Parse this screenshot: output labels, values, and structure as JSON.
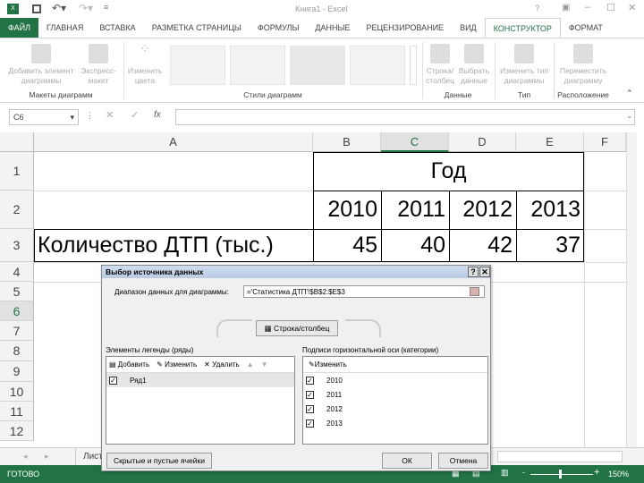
{
  "title": "Книга1 - Excel",
  "quick_access": [
    "save-icon",
    "undo-icon",
    "redo-icon",
    "customize-icon"
  ],
  "window_controls": [
    "?",
    "restore-icon",
    "minimize-icon",
    "maximize-icon",
    "close-icon"
  ],
  "tabs": [
    "ФАЙЛ",
    "ГЛАВНАЯ",
    "ВСТАВКА",
    "РАЗМЕТКА СТРАНИЦЫ",
    "ФОРМУЛЫ",
    "ДАННЫЕ",
    "РЕЦЕНЗИРОВАНИЕ",
    "ВИД",
    "КОНСТРУКТОР",
    "ФОРМАТ"
  ],
  "active_tab": "КОНСТРУКТОР",
  "ribbon": {
    "add_element": "Добавить элемент диаграммы",
    "express": "Экспресс-макет",
    "change_colors": "Изменить цвета",
    "row_col": "Строка/ столбец",
    "select_data": "Выбрать данные",
    "change_type": "Изменить тип диаграммы",
    "move_chart": "Переместить диаграмму",
    "groups": [
      "Макеты диаграмм",
      "Стили диаграмм",
      "Данные",
      "Тип",
      "Расположение"
    ]
  },
  "name_box": "C6",
  "formula": "",
  "columns": [
    "A",
    "B",
    "C",
    "D",
    "E",
    "F"
  ],
  "selected_column": "C",
  "rows": [
    "1",
    "2",
    "3",
    "4",
    "5",
    "6",
    "7",
    "8",
    "9",
    "10",
    "11",
    "12"
  ],
  "selected_row": "6",
  "cells": {
    "B1": "Год",
    "B2": "2010",
    "C2": "2011",
    "D2": "2012",
    "E2": "2013",
    "A3": "Количество ДТП (тыс.)",
    "B3": "45",
    "C3": "40",
    "D3": "42",
    "E3": "37"
  },
  "sheet_tab": "Лист",
  "status": {
    "ready": "ГОТОВО",
    "zoom": "150%"
  },
  "dialog": {
    "title": "Выбор источника данных",
    "range_label": "Диапазон данных для диаграммы:",
    "range_value": "='Статистика ДТП'!$B$2:$E$3",
    "switch": "Строка/столбец",
    "legend_label": "Элементы легенды (ряды)",
    "add": "Добавить",
    "edit": "Изменить",
    "delete": "Удалить",
    "series": [
      {
        "name": "Ряд1",
        "checked": true
      }
    ],
    "axis_label": "Подписи горизонтальной оси (категории)",
    "axis_edit": "Изменить",
    "categories": [
      {
        "name": "2010",
        "checked": true
      },
      {
        "name": "2011",
        "checked": true
      },
      {
        "name": "2012",
        "checked": true
      },
      {
        "name": "2013",
        "checked": true
      }
    ],
    "hidden": "Скрытые и пустые ячейки",
    "ok": "ОК",
    "cancel": "Отмена"
  }
}
